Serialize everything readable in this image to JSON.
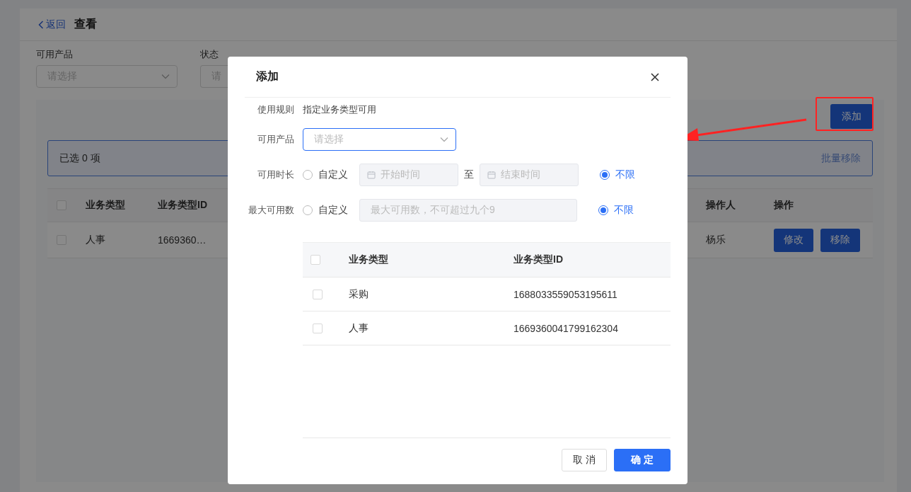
{
  "page": {
    "back_link": "返回",
    "title": "查看",
    "filters": [
      {
        "label": "可用产品",
        "placeholder": "请选择"
      },
      {
        "label": "状态",
        "placeholder": "请"
      }
    ],
    "add_button": "添加",
    "selection_bar": {
      "text": "已选 0 项",
      "action": "批量移除"
    },
    "table": {
      "columns": [
        "业务类型",
        "业务类型ID",
        "操作人",
        "操作"
      ],
      "header_checked": false,
      "rows": [
        {
          "cells": [
            "人事",
            "1669360…",
            "杨乐"
          ],
          "actions": [
            "修改",
            "移除"
          ],
          "checked": false
        }
      ]
    }
  },
  "dialog": {
    "title": "添加",
    "fields": [
      {
        "kind": "text",
        "label": "使用规则",
        "value": "指定业务类型可用"
      },
      {
        "kind": "select",
        "label": "可用产品",
        "placeholder": "请选择",
        "focused": true
      },
      {
        "kind": "date_range",
        "label": "可用时长",
        "options": [
          {
            "label": "自定义",
            "selected": false
          },
          {
            "label": "不限",
            "selected": true
          }
        ],
        "start_placeholder": "开始时间",
        "separator": "至",
        "end_placeholder": "结束时间"
      },
      {
        "kind": "number",
        "label": "最大可用数",
        "options": [
          {
            "label": "自定义",
            "selected": false
          },
          {
            "label": "不限",
            "selected": true
          }
        ],
        "placeholder": "最大可用数，不可超过九个9"
      }
    ],
    "table": {
      "columns": [
        "业务类型",
        "业务类型ID"
      ],
      "header_checked": false,
      "rows": [
        {
          "name": "采购",
          "id": "1688033559053195611",
          "checked": false
        },
        {
          "name": "人事",
          "id": "1669360041799162304",
          "checked": false
        }
      ]
    },
    "buttons": [
      {
        "label": "取消",
        "kind": "default"
      },
      {
        "label": "确定",
        "kind": "primary"
      }
    ]
  }
}
